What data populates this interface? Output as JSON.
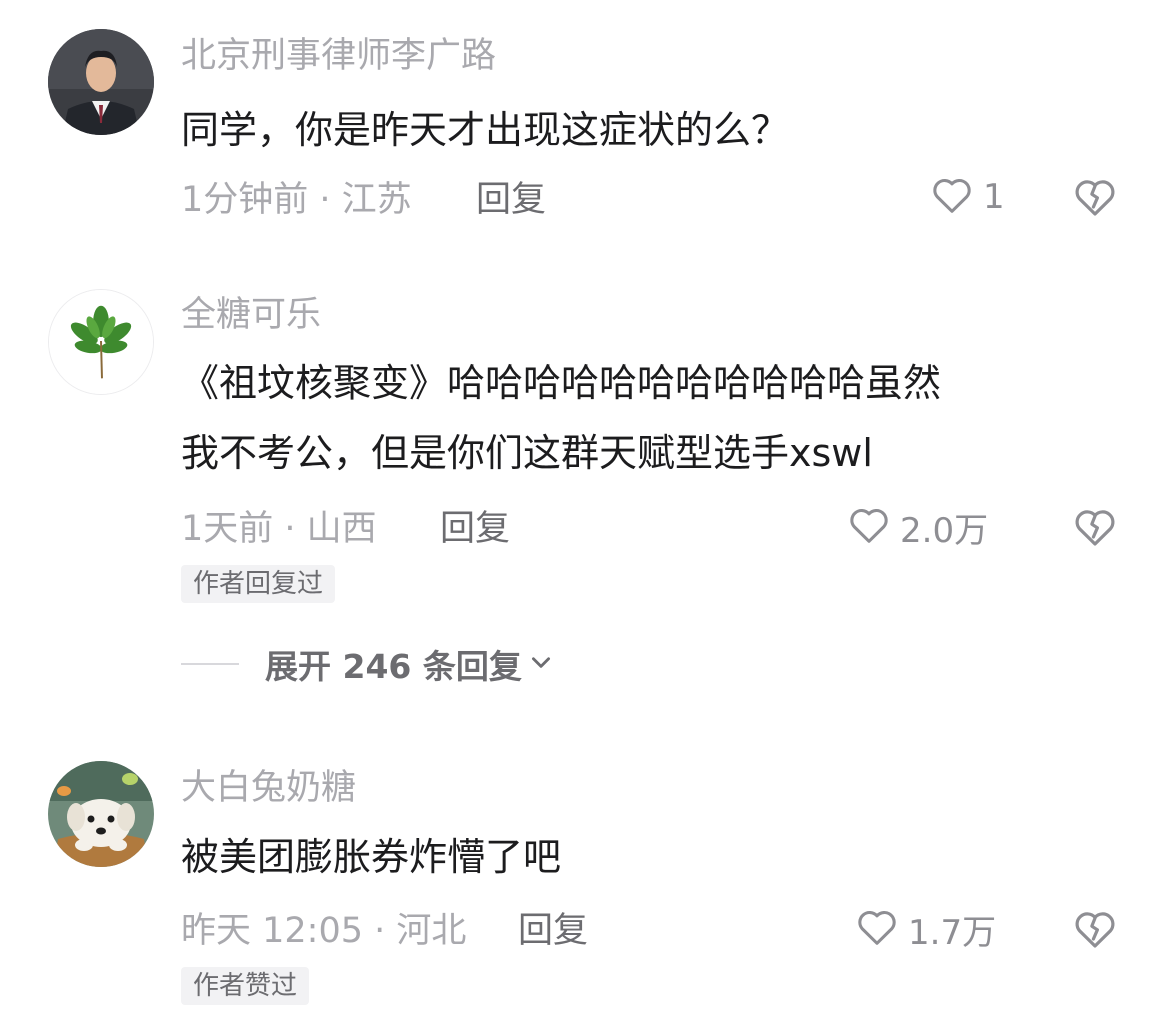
{
  "comments": [
    {
      "username": "北京刑事律师李广路",
      "lines": [
        "同学，你是昨天才出现这症状的么？"
      ],
      "meta": "1分钟前 · 江苏",
      "reply_label": "回复",
      "like_count": "1",
      "avatar_icon": "lawyer-avatar"
    },
    {
      "username": "全糖可乐",
      "lines": [
        "《祖坟核聚变》哈哈哈哈哈哈哈哈哈哈哈虽然",
        "我不考公，但是你们这群天赋型选手xswl"
      ],
      "meta": "1天前 · 山西",
      "reply_label": "回复",
      "like_count": "2.0万",
      "badge": "作者回复过",
      "expand_label": "展开 246 条回复",
      "avatar_icon": "leaves-avatar"
    },
    {
      "username": "大白兔奶糖",
      "lines": [
        "被美团膨胀券炸懵了吧"
      ],
      "meta": "昨天 12:05 · 河北",
      "reply_label": "回复",
      "like_count": "1.7万",
      "badge": "作者赞过",
      "avatar_icon": "puppy-avatar"
    }
  ],
  "icons": {
    "like": "heart-outline-icon",
    "dislike": "broken-heart-icon",
    "expand": "chevron-down-icon"
  },
  "colors": {
    "username": "#a9a9ae",
    "text": "#1c1c1e",
    "meta": "#a9a9ae",
    "reply": "#6c6c70",
    "badge_bg": "#f2f2f4"
  }
}
